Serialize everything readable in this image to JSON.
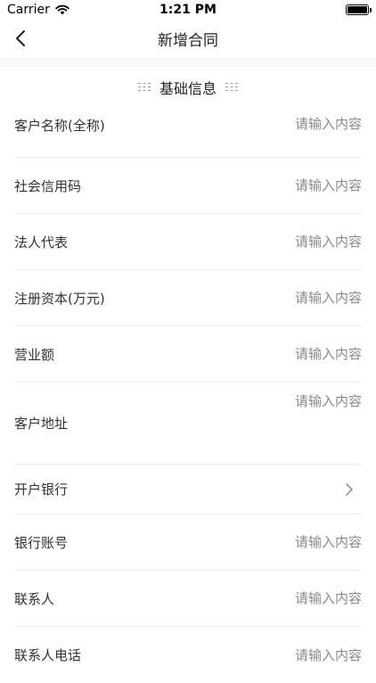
{
  "status_bar": {
    "carrier": "Carrier",
    "time": "1:21 PM"
  },
  "nav": {
    "title": "新增合同"
  },
  "section": {
    "title": "基础信息"
  },
  "form": {
    "placeholder": "请输入内容",
    "rows": [
      {
        "label": "客户名称(全称)",
        "type": "input"
      },
      {
        "label": "社会信用码",
        "type": "input"
      },
      {
        "label": "法人代表",
        "type": "input"
      },
      {
        "label": "注册资本(万元)",
        "type": "input"
      },
      {
        "label": "营业额",
        "type": "input"
      },
      {
        "label": "客户地址",
        "type": "textarea"
      },
      {
        "label": "开户银行",
        "type": "select"
      },
      {
        "label": "银行账号",
        "type": "input"
      },
      {
        "label": "联系人",
        "type": "input"
      },
      {
        "label": "联系人电话",
        "type": "input"
      }
    ]
  },
  "icons": {
    "back": "chevron-left-icon",
    "select": "chevron-right-icon",
    "wifi": "wifi-icon",
    "battery": "battery-icon"
  }
}
